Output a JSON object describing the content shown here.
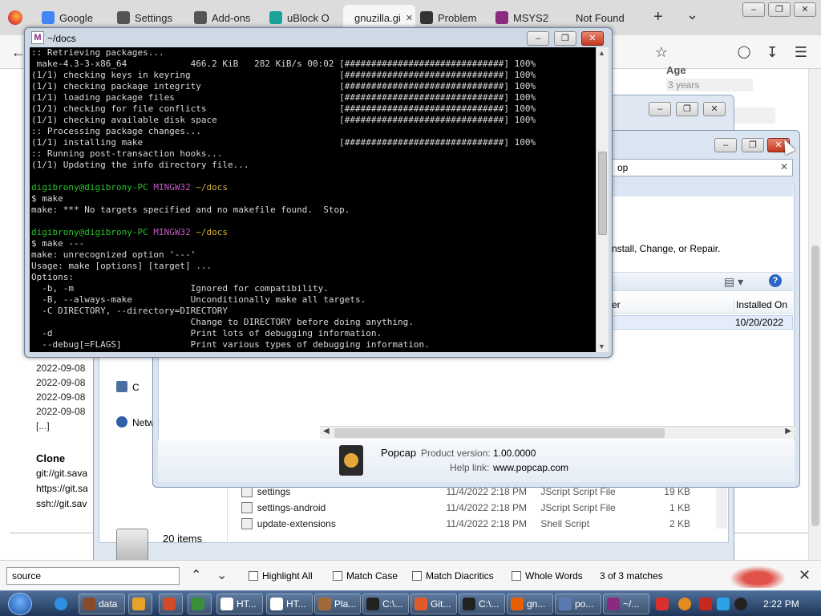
{
  "browser": {
    "tabs": [
      {
        "label": "Google",
        "icon": "google-icon",
        "color": "#4285f4"
      },
      {
        "label": "Settings",
        "icon": "gear-icon",
        "color": "#555555"
      },
      {
        "label": "Add-ons",
        "icon": "puzzle-icon",
        "color": "#555555"
      },
      {
        "label": "uBlock O",
        "icon": "ublock-icon",
        "color": "#1aa39b"
      },
      {
        "label": "gnuzilla.gi",
        "icon": "tab-icon",
        "color": "#888888",
        "active": true
      },
      {
        "label": "Problem",
        "icon": "info-icon",
        "color": "#333333"
      },
      {
        "label": "MSYS2",
        "icon": "msys2-icon",
        "color": "#8a2b7f"
      },
      {
        "label": "Not Found",
        "icon": "",
        "color": ""
      }
    ],
    "new_tab": "+",
    "tab_list": "⌄",
    "close_tab": "✕"
  },
  "webpage": {
    "age_header": "Age",
    "age_value": "3 years",
    "dates": [
      "2022-09-08",
      "2022-09-08",
      "2022-09-08",
      "2022-09-08"
    ],
    "ellipsis": "[...]",
    "clone_title": "Clone",
    "clone_urls": [
      "git://git.sava",
      "https://git.sa",
      "ssh://git.sav"
    ]
  },
  "explorer": {
    "nav_items": [
      "C",
      "Netw"
    ],
    "files": [
      {
        "name": "settings",
        "date": "11/4/2022 2:18 PM",
        "type": "JScript Script File",
        "size": "19 KB"
      },
      {
        "name": "settings-android",
        "date": "11/4/2022 2:18 PM",
        "type": "JScript Script File",
        "size": "1 KB"
      },
      {
        "name": "update-extensions",
        "date": "11/4/2022 2:18 PM",
        "type": "Shell Script",
        "size": "2 KB"
      }
    ],
    "status": "20 items"
  },
  "programs": {
    "search_value": "op",
    "hint": "nstall, Change, or Repair.",
    "columns": [
      "er",
      "Installed On"
    ],
    "row_date": "10/20/2022",
    "detail_name": "Popcap",
    "product_version_label": "Product version:",
    "product_version": "1.00.0000",
    "help_link_label": "Help link:",
    "help_link": "www.popcap.com"
  },
  "terminal": {
    "title": "~/docs",
    "lines": [
      ":: Retrieving packages...",
      " make-4.3-3-x86_64            466.2 KiB   282 KiB/s 00:02 [##############################] 100%",
      "(1/1) checking keys in keyring                            [##############################] 100%",
      "(1/1) checking package integrity                          [##############################] 100%",
      "(1/1) loading package files                               [##############################] 100%",
      "(1/1) checking for file conflicts                         [##############################] 100%",
      "(1/1) checking available disk space                       [##############################] 100%",
      ":: Processing package changes...",
      "(1/1) installing make                                     [##############################] 100%",
      ":: Running post-transaction hooks...",
      "(1/1) Updating the info directory file...",
      "",
      "digibrony@digibrony-PC MINGW32 ~/docs",
      "$ make",
      "make: *** No targets specified and no makefile found.  Stop.",
      "",
      "digibrony@digibrony-PC MINGW32 ~/docs",
      "$ make ---",
      "make: unrecognized option '---'",
      "Usage: make [options] [target] ...",
      "Options:",
      "  -b, -m                      Ignored for compatibility.",
      "  -B, --always-make           Unconditionally make all targets.",
      "  -C DIRECTORY, --directory=DIRECTORY",
      "                              Change to DIRECTORY before doing anything.",
      "  -d                          Print lots of debugging information.",
      "  --debug[=FLAGS]             Print various types of debugging information."
    ]
  },
  "findbar": {
    "query": "source",
    "highlight_all": "Highlight All",
    "match_case": "Match Case",
    "match_diacritics": "Match Diacritics",
    "whole_words": "Whole Words",
    "result": "3 of 3 matches"
  },
  "taskbar": {
    "items": [
      {
        "label": "data",
        "color": "#8a4b2a"
      },
      {
        "label": "",
        "color": "#e8a22a"
      },
      {
        "label": "",
        "color": "#d24a2a"
      },
      {
        "label": "",
        "color": "#3b8f3b"
      },
      {
        "label": "HT...",
        "color": "#ffffff"
      },
      {
        "label": "HT...",
        "color": "#ffffff"
      },
      {
        "label": "Pla...",
        "color": "#a06a3a"
      },
      {
        "label": "C:\\...",
        "color": "#222222"
      },
      {
        "label": "Git...",
        "color": "#e05a2a"
      },
      {
        "label": "C:\\...",
        "color": "#222222"
      },
      {
        "label": "gn...",
        "color": "#e66000"
      },
      {
        "label": "po...",
        "color": "#5a7ab0"
      },
      {
        "label": "~/...",
        "color": "#8a2b7f"
      }
    ],
    "clock": "2:22 PM"
  }
}
